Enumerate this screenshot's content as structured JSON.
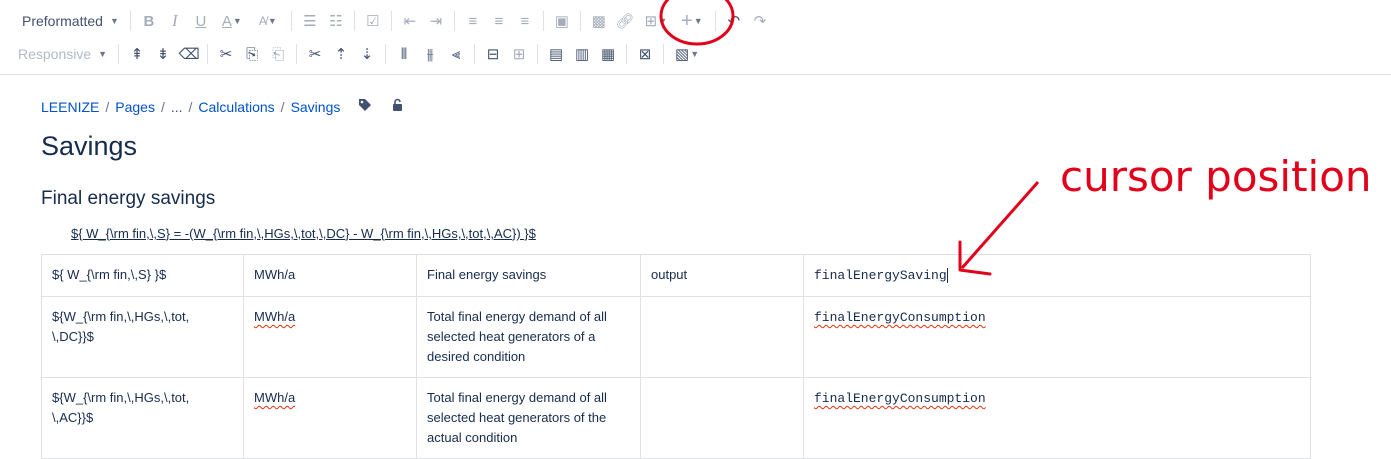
{
  "toolbar": {
    "format_select": "Preformatted",
    "responsive_select": "Responsive"
  },
  "breadcrumb": [
    "LEENIZE",
    "Pages",
    "...",
    "Calculations",
    "Savings"
  ],
  "page_title": "Savings",
  "section_title": "Final energy savings",
  "formula": "${ W_{\\rm fin,\\,S} = -(W_{\\rm fin,\\,HGs,\\,tot,\\,DC} - W_{\\rm fin,\\,HGs,\\,tot,\\,AC}) }$",
  "table": {
    "rows": [
      {
        "symbol": "${ W_{\\rm fin,\\,S} }$",
        "unit": "MWh/a",
        "description": "Final energy savings",
        "type": "output",
        "variable": "finalEnergySaving"
      },
      {
        "symbol": "${W_{\\rm fin,\\,HGs,\\,tot,\n\\,DC}}$",
        "unit": "MWh/a",
        "description": "Total final energy demand of all selected heat generators of a desired condition",
        "type": "",
        "variable": "finalEnergyConsumption"
      },
      {
        "symbol": "${W_{\\rm fin,\\,HGs,\\,tot,\n\\,AC}}$",
        "unit": "MWh/a",
        "description": "Total final energy demand of all selected heat generators of the actual condition",
        "type": "",
        "variable": "finalEnergyConsumption"
      }
    ]
  },
  "annotation": {
    "label": "cursor position",
    "color": "#e2001a"
  },
  "colors": {
    "link": "#0052cc",
    "text": "#172b4d",
    "annotation": "#e2001a"
  }
}
